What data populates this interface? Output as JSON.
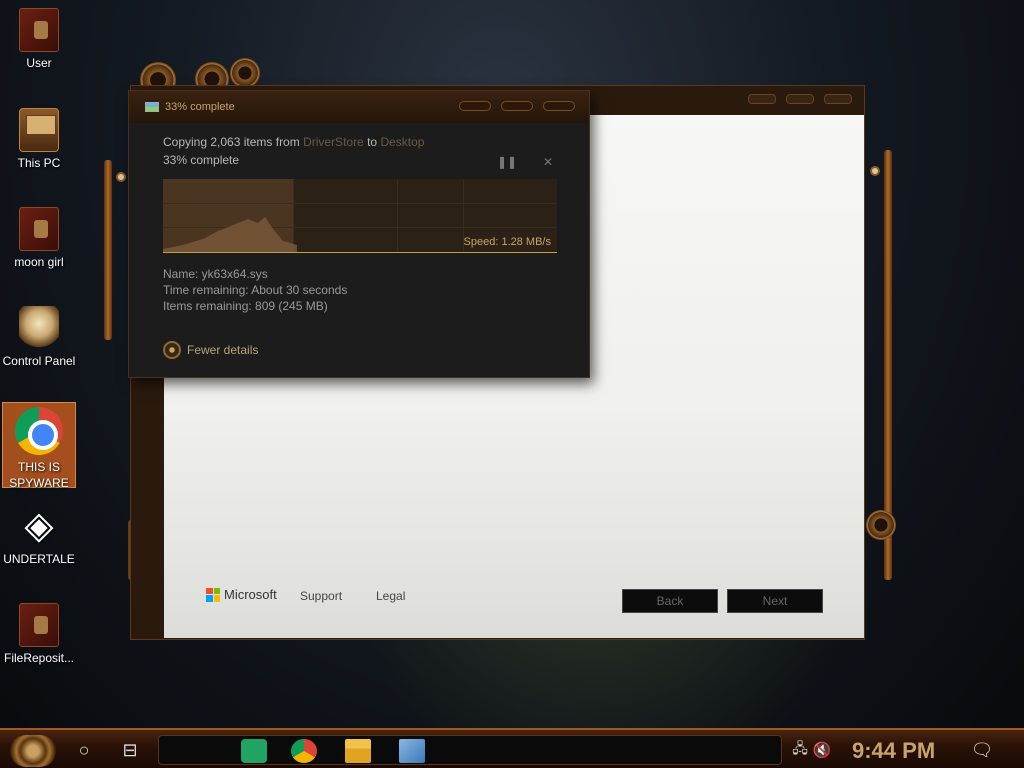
{
  "desktop": {
    "icons": [
      {
        "label": "User",
        "icon": "steampunk-book-icon"
      },
      {
        "label": "This PC",
        "icon": "steampunk-computer-icon"
      },
      {
        "label": "moon girl",
        "icon": "steampunk-folder-icon"
      },
      {
        "label": "Control Panel",
        "icon": "lightbulb-icon"
      },
      {
        "label": "THIS IS SPYWARE",
        "icon": "chrome-icon"
      },
      {
        "label": "UNDERTALE",
        "icon": "unity-icon"
      },
      {
        "label": "FileReposit...",
        "icon": "steampunk-book-icon"
      }
    ]
  },
  "setup_window": {
    "brand": "Microsoft",
    "links": {
      "support": "Support",
      "legal": "Legal"
    },
    "buttons": {
      "back": "Back",
      "next": "Next"
    }
  },
  "copy_dialog": {
    "title": "33% complete",
    "copy_prefix": "Copying 2,063 items from ",
    "source": "DriverStore",
    "copy_mid": " to ",
    "destination": "Desktop",
    "progress_text": "33% complete",
    "progress_fraction": 0.33,
    "speed": "Speed: 1.28 MB/s",
    "name_line": "Name:  yk63x64.sys",
    "time_line": "Time remaining:  About 30 seconds",
    "items_line": "Items remaining:  809 (245 MB)",
    "fewer_details": "Fewer details",
    "pause_glyph": "❚❚",
    "close_glyph": "✕"
  },
  "taskbar": {
    "clock": "9:44 PM",
    "apps": [
      "sheets-icon",
      "chrome-icon",
      "file-explorer-icon",
      "paint-icon"
    ]
  },
  "colors": {
    "accent": "#c9a46a",
    "selected_icon_bg": "#be5a1e"
  }
}
